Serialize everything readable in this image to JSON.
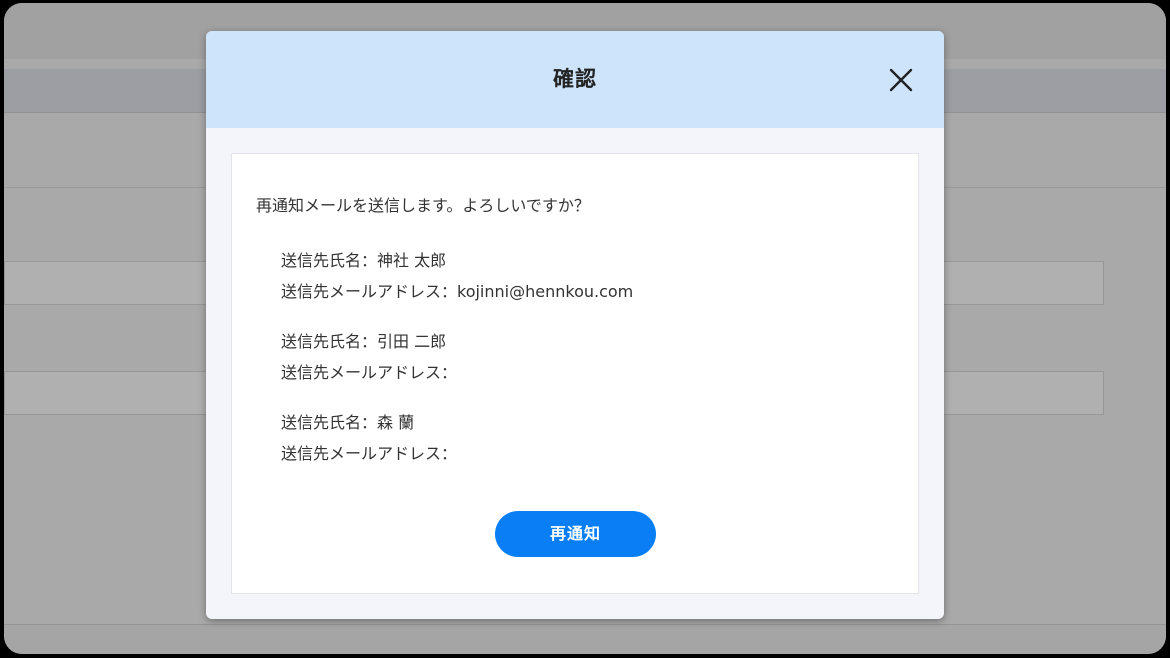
{
  "dialog": {
    "title": "確認",
    "close_icon": "close-icon",
    "message": "再通知メールを送信します。よろしいですか？",
    "recipients": [
      {
        "name_line": "送信先氏名：神社 太郎",
        "email_line": "送信先メールアドレス：kojinni@hennkou.com"
      },
      {
        "name_line": "送信先氏名：引田 二郎",
        "email_line": "送信先メールアドレス："
      },
      {
        "name_line": "送信先氏名：森 蘭",
        "email_line": "送信先メールアドレス："
      }
    ],
    "confirm_label": "再通知"
  },
  "colors": {
    "header_bg": "#cde4fb",
    "button_bg": "#0a7ff5",
    "overlay": "#a9a9a9"
  }
}
